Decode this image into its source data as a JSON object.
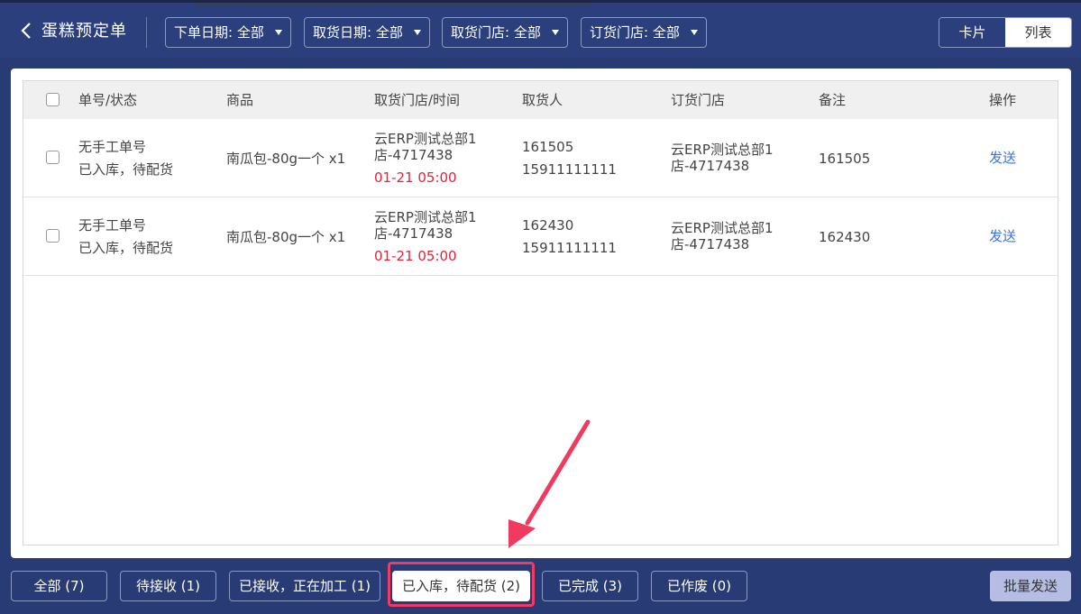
{
  "header": {
    "title": "蛋糕预定单",
    "filters": [
      {
        "label": "下单日期: 全部"
      },
      {
        "label": "取货日期: 全部"
      },
      {
        "label": "取货门店: 全部"
      },
      {
        "label": "订货门店: 全部"
      }
    ],
    "view_toggle": {
      "card": "卡片",
      "list": "列表",
      "selected": "列表"
    }
  },
  "table": {
    "columns": [
      "单号/状态",
      "商品",
      "取货门店/时间",
      "取货人",
      "订货门店",
      "备注",
      "操作"
    ],
    "rows": [
      {
        "order_no": "无手工单号",
        "status": "已入库，待配货",
        "product": "南瓜包-80g一个 x1",
        "pickup_store_line1": "云ERP测试总部1",
        "pickup_store_line2": "店-4717438",
        "pickup_time": "01-21 05:00",
        "picker_name": "161505",
        "picker_phone": "15911111111",
        "order_store_line1": "云ERP测试总部1",
        "order_store_line2": "店-4717438",
        "remark": "161505",
        "action": "发送"
      },
      {
        "order_no": "无手工单号",
        "status": "已入库，待配货",
        "product": "南瓜包-80g一个 x1",
        "pickup_store_line1": "云ERP测试总部1",
        "pickup_store_line2": "店-4717438",
        "pickup_time": "01-21 05:00",
        "picker_name": "162430",
        "picker_phone": "15911111111",
        "order_store_line1": "云ERP测试总部1",
        "order_store_line2": "店-4717438",
        "remark": "162430",
        "action": "发送"
      }
    ]
  },
  "status_tabs": [
    {
      "label": "全部 (7)"
    },
    {
      "label": "待接收 (1)"
    },
    {
      "label": "已接收，正在加工 (1)"
    },
    {
      "label": "已入库，待配货 (2)",
      "active": true
    },
    {
      "label": "已完成 (3)"
    },
    {
      "label": "已作废 (0)"
    }
  ],
  "batch_send_label": "批量发送",
  "colors": {
    "header_bg": "#2b3f7c",
    "accent_red": "#e5223d",
    "link_blue": "#3b73e0",
    "highlight": "#f03a5f"
  },
  "icons": {
    "back": "chevron-left-icon",
    "caret": "caret-down-icon",
    "annotation": "red-arrow"
  }
}
